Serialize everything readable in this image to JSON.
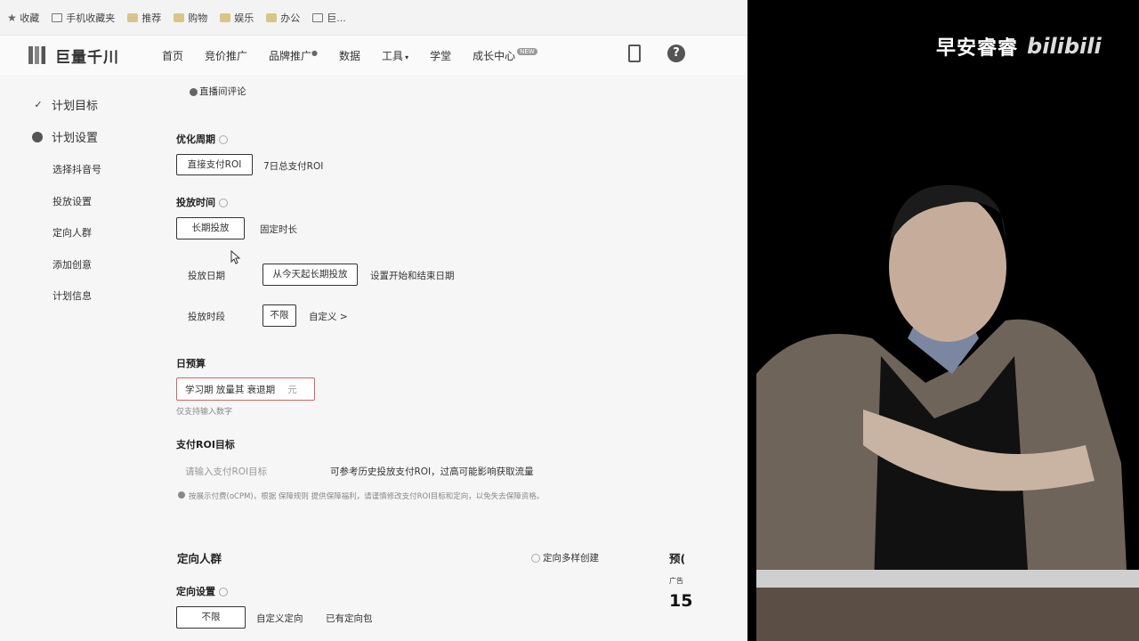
{
  "bookmarks": [
    "收藏",
    "手机收藏夹",
    "推荐",
    "购物",
    "娱乐",
    "办公",
    "巨..."
  ],
  "logo": "巨量千川",
  "nav": {
    "items": [
      "首页",
      "竞价推广",
      "品牌推广",
      "数据",
      "工具",
      "学堂",
      "成长中心"
    ],
    "badge": "NEW"
  },
  "sidebar": {
    "plan_goal": "计划目标",
    "plan_settings": "计划设置",
    "subs": [
      "选择抖音号",
      "投放设置",
      "定向人群",
      "添加创意",
      "计划信息"
    ]
  },
  "form": {
    "live_comment": "直播间评论",
    "opt_period": {
      "label": "优化周期",
      "options": [
        "直接支付ROI",
        "7日总支付ROI"
      ]
    },
    "time": {
      "label": "投放时间",
      "options": [
        "长期投放",
        "固定时长"
      ],
      "date_label": "投放日期",
      "date_options": [
        "从今天起长期投放",
        "设置开始和结束日期"
      ],
      "slot_label": "投放时段",
      "slot_options": [
        "不限",
        "自定义 >"
      ]
    },
    "budget": {
      "label": "日预算",
      "input_value": "学习期 放量其 衰退期",
      "unit": "元",
      "hint": "仅支持输入数字"
    },
    "roi": {
      "label": "支付ROI目标",
      "placeholder": "请输入支付ROI目标",
      "note": "可参考历史投放支付ROI，过高可能影响获取流量",
      "footer": "按展示付费(oCPM)，根据 保障规则 提供保障福利，请谨慎修改支付ROI目标和定向，以免失去保障资格。"
    },
    "targeting": {
      "title": "定向人群",
      "multi": "定向多样创建",
      "setting_label": "定向设置",
      "options": [
        "不限",
        "自定义定向",
        "已有定向包"
      ],
      "preview_title": "预(",
      "preview_sub": "广告",
      "preview_num": "15"
    }
  },
  "watermark": {
    "text": "早安睿睿",
    "brand": "bilibili"
  }
}
